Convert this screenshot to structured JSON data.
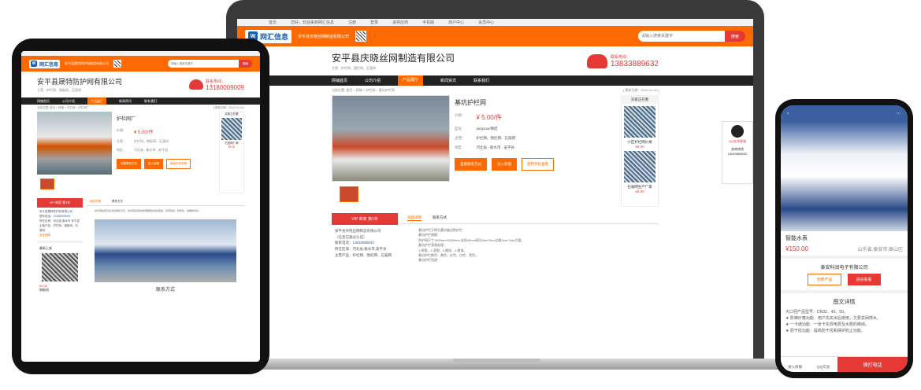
{
  "laptop": {
    "topbar": [
      "首页",
      "您好，欢迎来到网汇信息",
      "注册",
      "登录",
      "进供应商",
      "手机版",
      "商户中心",
      "会员中心"
    ],
    "logo_text": "网汇信息",
    "header_company": "安平县庆晓丝网制造有限公司",
    "search_placeholder": "请输入搜索关键字",
    "search_button": "搜索",
    "company_name": "安平县庆晓丝网制造有限公司",
    "main_products": "主营：护栏网、围栏网、石笼网",
    "tel_label": "联系热线：",
    "tel_number": "13833889632",
    "nav": [
      "网铺首页",
      "公司介绍",
      "产品展厅",
      "新闻资讯",
      "联系我们"
    ],
    "breadcrumb": "当前位置: 首页 > 网铺 > 护栏网 > 基坑护栏网",
    "update_date": "[ 更新日期：2019-04-24 ]",
    "product": {
      "title": "基坑护栏网",
      "price_label": "价格：",
      "price": "¥ 5.00/件",
      "model_label": "型号：",
      "model": "qingxiao/钢结",
      "main_label": "主营：",
      "main": "护栏网、围栏网、石笼网",
      "area_label": "地区：",
      "area": "河北省 - 衡水市 - 安平县",
      "btn_contact": "查看联系方式",
      "btn_shop": "进入商铺",
      "btn_mobile": "使用手机查看"
    },
    "side": {
      "title": "买家正在看",
      "item1": "小区护栏网价格",
      "price1": "¥5.00",
      "item2": "石笼网生产厂家",
      "price2": "¥5.00"
    },
    "vip": {
      "header": "VIP 商家  第1年",
      "company": "安平县庆晓丝网制造有限公司",
      "verified": "（信息已通过认证）",
      "phone_label": "联系电话：",
      "phone": "13833889632",
      "area_label": "所在区域：",
      "area": "河北省,衡水市,安平县",
      "main_label": "主营产品：",
      "main": "护栏网、围栏网、石笼网"
    },
    "tabs": [
      "商品详情",
      "联系方式"
    ],
    "detail_lines": [
      "基坑护栏又称为基坑临边防护栏",
      "基坑护栏规格：",
      "防护网尺寸1200mm*2000mm 丝径40mm网孔5cm*5cm边框2cm*2cm方管。",
      "基坑护栏表面处理：",
      "1.喷塑。2.浸塑。3.镀锌。4.烤漆。",
      "基坑护栏颜色：黄色、红色、白色、黑色。",
      "基坑护栏用途："
    ],
    "qq": {
      "label": "QQ在线客服",
      "service": "咨询热线",
      "number": "13833889632"
    }
  },
  "ipad": {
    "header_company": "安平县晟特防护网制造有限公司",
    "search_placeholder": "请输入搜索关键字",
    "search_button": "搜索",
    "company_name": "安平县晟特防护网有限公司",
    "main_products": "主营：护栏网、钢板网、石笼网",
    "tel_label": "联系热线：",
    "tel_number": "13180009009",
    "nav": [
      "网铺首页",
      "公司介绍",
      "产品展厅",
      "新闻资讯",
      "联系我们"
    ],
    "breadcrumb": "当前位置: 首页 > 网铺 > 护栏网 > 护栏网厂",
    "date": "[ 更新日期：2019-04-24 ]",
    "product": {
      "title": "护栏网厂",
      "price_label": "价格：",
      "price": "¥ 5.00/件",
      "main_label": "主营：",
      "main": "护栏网、钢板网、石笼网",
      "area_label": "地区：",
      "area": "河北省 - 衡水市 - 安平县",
      "btn_contact": "查看联系方式",
      "btn_shop": "进入商铺",
      "btn_mobile": "使用手机查看"
    },
    "side": {
      "title": "买家正在看",
      "item": "石笼网厂家",
      "price": "¥5.00"
    },
    "vip": {
      "header": "VIP 商家  第1年",
      "company": "安平县晟特防护网有限公司",
      "phone_label": "联系电话：",
      "phone": "13180009009",
      "area_label": "所在区域：",
      "area": "河北省,衡水市,安平县",
      "main_label": "主营产品：",
      "main": "护栏网、钢板网、石笼网",
      "safe": "安全保障"
    },
    "tabs": [
      "商品详情",
      "联系方式"
    ],
    "detail": "护栏网在我们生活中随处可见，护栏网采用优质低碳钢丝焊接而成，具有防腐、耐老化、抗晒的特点。",
    "contact_title": "联系方式",
    "latest": "最新上架",
    "latest_price": "¥5.00",
    "latest_item": "钢板网"
  },
  "phone": {
    "product": "智能水表",
    "price": "¥150.00",
    "location": "山东省,泰安市,泰山区",
    "company": "泰安科润电子有限公司",
    "btn_all": "全部产品",
    "btn_shop": "进店看看",
    "detail_title": "图文详情",
    "detail_lines": [
      "大口径产品型号：DN32、40、50。",
      "★ 阶梯价格功能：用户先买水后使用，欠费关阀停水。",
      "★ 一卡通功能：一张卡实现电费及水费的缴纳。",
      "★ 防干扰功能：提高防干扰和保护防止功能。"
    ],
    "bottom": [
      "进入商铺",
      "QQ交谈"
    ],
    "call": "拨打电话"
  }
}
